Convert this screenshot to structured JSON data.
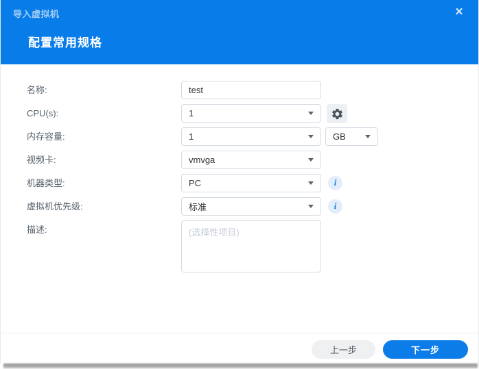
{
  "dialog": {
    "title": "导入虚拟机",
    "heading": "配置常用规格",
    "close_glyph": "×"
  },
  "form": {
    "fields": [
      {
        "label": "名称:",
        "type": "text",
        "value": "test"
      },
      {
        "label": "CPU(s):",
        "type": "select",
        "value": "1"
      },
      {
        "label": "内存容量:",
        "type": "select",
        "value": "1",
        "unit": "GB"
      },
      {
        "label": "视频卡:",
        "type": "select",
        "value": "vmvga"
      },
      {
        "label": "机器类型:",
        "type": "select",
        "value": "PC",
        "info": "i"
      },
      {
        "label": "虚拟机优先级:",
        "type": "select",
        "value": "标准",
        "info": "i"
      },
      {
        "label": "描述:",
        "type": "textarea",
        "placeholder": "(选择性项目)"
      }
    ]
  },
  "footer": {
    "back_label": "上一步",
    "next_label": "下一步"
  },
  "colors": {
    "header_blue": "#087ce8",
    "accent_blue": "#0c7ce8",
    "info_bg": "#e4eefb",
    "gear_btn_bg": "#edf0f3"
  }
}
